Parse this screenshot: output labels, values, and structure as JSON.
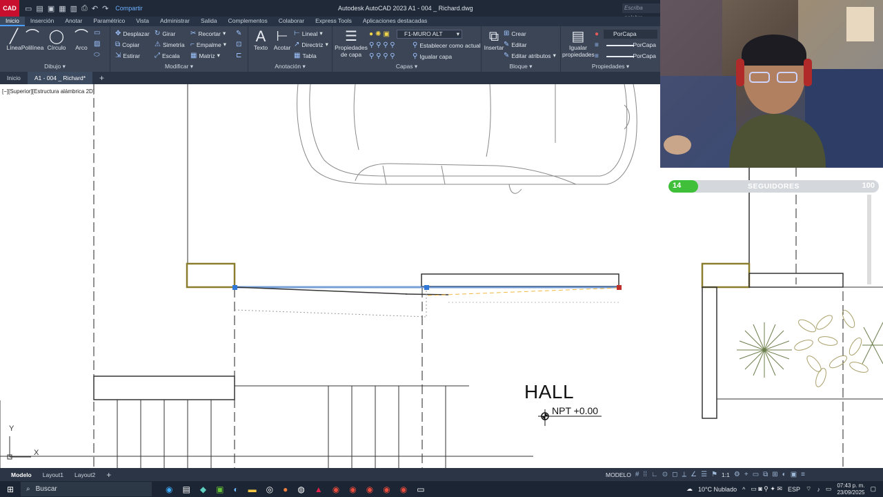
{
  "titlebar": {
    "app_badge": "CAD",
    "share": "Compartir",
    "title": "Autodesk AutoCAD 2023    A1 - 004 _ Richard.dwg",
    "search_placeholder": "Escriba palabra"
  },
  "ribbon_tabs": [
    "Inicio",
    "Inserción",
    "Anotar",
    "Paramétrico",
    "Vista",
    "Administrar",
    "Salida",
    "Complementos",
    "Colaborar",
    "Express Tools",
    "Aplicaciones destacadas"
  ],
  "ribbon": {
    "draw": {
      "title": "Dibujo",
      "tools": [
        "Línea",
        "Polilínea",
        "Círculo",
        "Arco"
      ]
    },
    "modify": {
      "title": "Modificar",
      "tools": [
        "Desplazar",
        "Girar",
        "Recortar",
        "Copiar",
        "Simetría",
        "Empalme",
        "Estirar",
        "Escala",
        "Matriz"
      ]
    },
    "annotation": {
      "title": "Anotación",
      "big": [
        "Texto",
        "Acotar"
      ],
      "tools": [
        "Lineal",
        "Directriz",
        "Tabla"
      ]
    },
    "layers": {
      "title": "Capas",
      "big": "Propiedades de capa",
      "current_layer": "F1-MURO ALT",
      "tools": [
        "Establecer como actual",
        "Igualar capa"
      ]
    },
    "block": {
      "title": "Bloque",
      "big": "Insertar",
      "tools": [
        "Crear",
        "Editar",
        "Editar atributos"
      ]
    },
    "properties": {
      "title": "Propiedades",
      "big": "Igualar propiedades",
      "color": "PorCapa",
      "linetype": "PorCapa",
      "lineweight": "PorCapa"
    }
  },
  "doc_tabs": [
    "Inicio",
    "A1 - 004 _ Richard*"
  ],
  "viewport_label": "[−][Superior][Estructura alámbrica 2D]",
  "drawing": {
    "room_name": "HALL",
    "level": "NPT +0.00",
    "ucs_x": "X",
    "ucs_y": "Y"
  },
  "followers_widget": {
    "current": "14",
    "label": "SEGUIDORES",
    "goal": "100",
    "progress": 0.14,
    "color": "#3fbf3a"
  },
  "layout_tabs": [
    "Modelo",
    "Layout1",
    "Layout2"
  ],
  "status": {
    "mode": "MODELO",
    "scale": "1:1"
  },
  "taskbar": {
    "search": "Buscar",
    "weather": "10°C  Nublado",
    "language": "ESP",
    "time": "07:43 p. m.",
    "date": "23/09/2025"
  }
}
